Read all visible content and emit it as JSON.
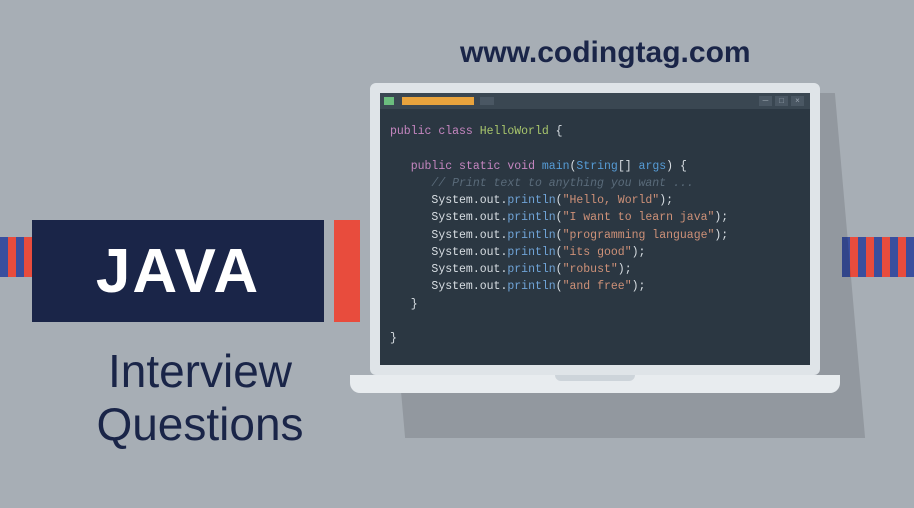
{
  "url": "www.codingtag.com",
  "badge": "JAVA",
  "subtitle_line1": "Interview",
  "subtitle_line2": "Questions",
  "code": {
    "kw_public": "public",
    "kw_class": "class",
    "className": "HelloWorld",
    "brace_open": "{",
    "kw_static": "static",
    "kw_void": "void",
    "main": "main",
    "params_open": "(",
    "type_string": "String",
    "arr": "[]",
    "arg": "args",
    "params_close": ")",
    "comment": "// Print text to anything you want ...",
    "sys": "System",
    "out": ".out.",
    "println": "println",
    "paren_open": "(",
    "paren_close": ");",
    "strings": [
      "\"Hello, World\"",
      "\"I want to learn java\"",
      "\"programming language\"",
      "\"its good\"",
      "\"robust\"",
      "\"and free\""
    ],
    "brace_close": "}"
  }
}
